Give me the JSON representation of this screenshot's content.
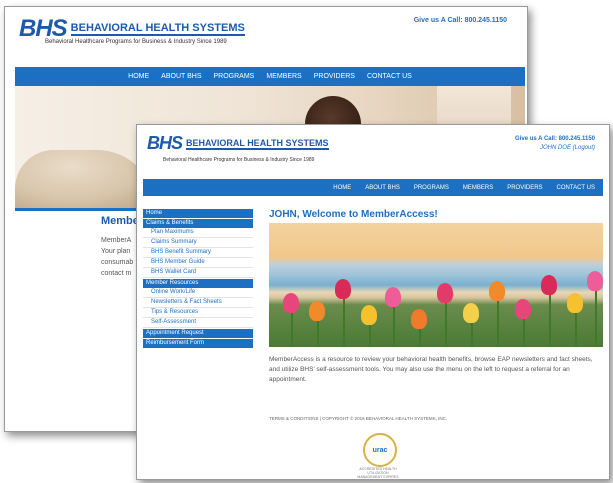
{
  "back": {
    "logo_mark": "BHS",
    "logo_name": "BEHAVIORAL HEALTH SYSTEMS",
    "tagline": "Behavioral Healthcare Programs for Business & Industry Since 1989",
    "call": "Give us A Call: 800.245.1150",
    "nav": [
      "HOME",
      "ABOUT BHS",
      "PROGRAMS",
      "MEMBERS",
      "PROVIDERS",
      "CONTACT US"
    ],
    "member_title": "Membe",
    "member_text": [
      "MemberA",
      "Your plan",
      "consumab",
      "contact m"
    ]
  },
  "front": {
    "logo_mark": "BHS",
    "logo_name": "BEHAVIORAL HEALTH SYSTEMS",
    "tagline": "Behavioral Healthcare Programs for Business & Industry Since 1989",
    "call": "Give us A Call: 800.245.1150",
    "user": "JOHN DOE",
    "logout": "(Logout)",
    "nav": [
      "HOME",
      "ABOUT BHS",
      "PROGRAMS",
      "MEMBERS",
      "PROVIDERS",
      "CONTACT US"
    ],
    "sidebar": [
      {
        "label": "Home",
        "type": "header"
      },
      {
        "label": "Claims & Benefits",
        "type": "header"
      },
      {
        "label": "Plan Maximums",
        "type": "item"
      },
      {
        "label": "Claims Summary",
        "type": "item"
      },
      {
        "label": "BHS Benefit Summary",
        "type": "item"
      },
      {
        "label": "BHS Member Guide",
        "type": "item"
      },
      {
        "label": "BHS Wallet Card",
        "type": "item"
      },
      {
        "label": "Member Resources",
        "type": "header"
      },
      {
        "label": "Online Work/Life",
        "type": "item"
      },
      {
        "label": "Newsletters & Fact Sheets",
        "type": "item"
      },
      {
        "label": "Tips & Resources",
        "type": "item"
      },
      {
        "label": "Self-Assessment",
        "type": "item"
      },
      {
        "label": "Appointment Request",
        "type": "header"
      },
      {
        "label": "Reimbursement Form",
        "type": "header"
      }
    ],
    "welcome": "JOHN, Welcome to MemberAccess!",
    "description": "MemberAccess is a resource to review your behavioral health benefits, browse EAP newsletters and fact sheets, and utilize BHS' self-assessment tools. You may also use the menu on the left to request a referral for an appointment.",
    "footer": "TERMS & CONDITIONS | COPYRIGHT © 2016 BEHAVIORAL HEALTH SYSTEMS, INC.",
    "badge": "urac",
    "badge_sub": "ACCREDITED HEALTH UTILIZATION MANAGEMENT EXPIRES 06/01/2019"
  },
  "colors": {
    "accent": "#1c6fc1",
    "brand": "#1e5aa8",
    "badge_ring": "#d7b24a"
  }
}
